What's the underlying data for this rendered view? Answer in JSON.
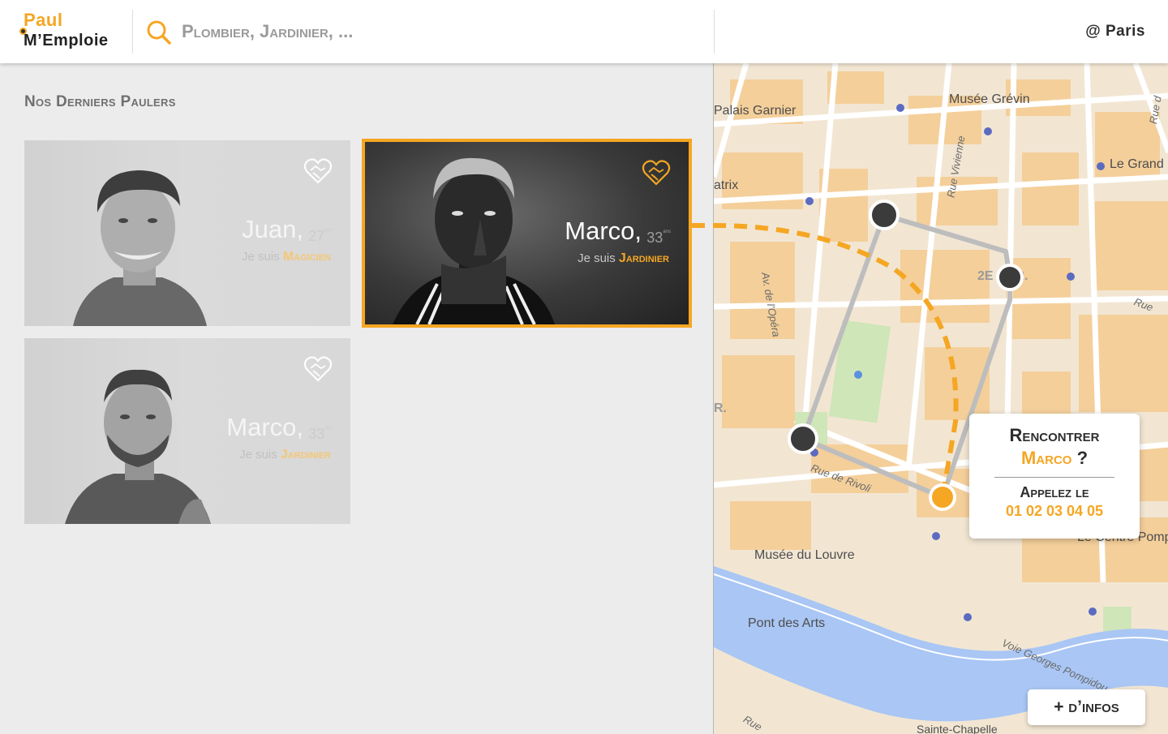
{
  "header": {
    "logo_line1": "Paul",
    "logo_line2": "M’Emploie",
    "search_placeholder": "Plombier, Jardinier, ...",
    "location": "@ Paris"
  },
  "section": {
    "title": "Nos Derniers Paulers"
  },
  "cards": [
    {
      "name": "Juan,",
      "age": "27",
      "age_suffix": "ans",
      "prefix": "Je suis",
      "role": "Magicien",
      "state": "dimmed"
    },
    {
      "name": "Marco,",
      "age": "33",
      "age_suffix": "ans",
      "prefix": "Je suis",
      "role": "Jardinier",
      "state": "selected"
    },
    {
      "name": "Marco,",
      "age": "33",
      "age_suffix": "ans",
      "prefix": "Je suis",
      "role": "Jardinier",
      "state": "dimmed"
    }
  ],
  "map": {
    "labels": {
      "palais_garnier": "Palais Garnier",
      "musee_grevin": "Musée Grévin",
      "le_grand": "Le Grand",
      "atrix": "atrix",
      "arr": "2E ARR.",
      "r": "R.",
      "musee_louvre": "Musée du Louvre",
      "pont_des_arts": "Pont des Arts",
      "centre_pomp": "Le Centre Pomp",
      "sainte_chapelle": "Sainte-Chapelle"
    },
    "streets": {
      "rue_vivienne": "Rue Vivienne",
      "av_opera": "Av. de l'Opéra",
      "rue_de_rivoli": "Rue de Rivoli",
      "vole_georges": "Voie Georges Pompidou",
      "rue_right1": "Rue d",
      "rue_right2": "Rue",
      "rue_bottom": "Rue"
    }
  },
  "tooltip": {
    "line1": "Rencontrer",
    "who": "Marco",
    "question": " ?",
    "line3": "Appelez le",
    "phone": "01 02 03 04 05"
  },
  "more_button": "+ d’infos",
  "colors": {
    "accent": "#f5a623",
    "dark": "#2e2e2e",
    "route": "#bdbdbd",
    "water": "#aac7f5"
  },
  "icons": [
    "search-icon",
    "handshake-heart-icon",
    "map-pin-icon"
  ]
}
